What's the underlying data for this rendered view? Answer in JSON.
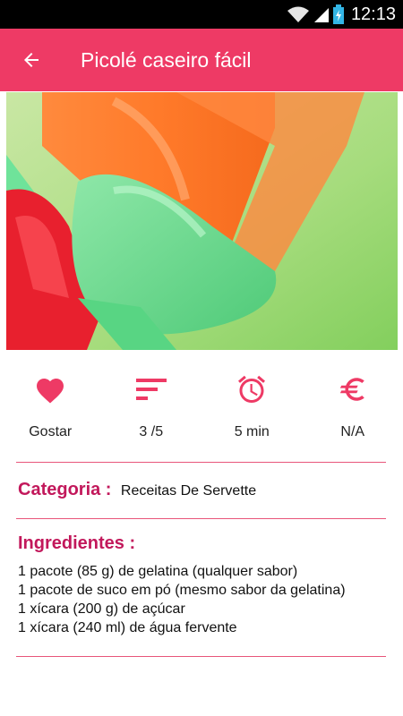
{
  "status_bar": {
    "time": "12:13"
  },
  "app_bar": {
    "title": "Picolé caseiro fácil"
  },
  "stats": [
    {
      "icon": "heart-icon",
      "label": "Gostar"
    },
    {
      "icon": "difficulty-icon",
      "label": "3 /5"
    },
    {
      "icon": "alarm-clock-icon",
      "label": "5 min"
    },
    {
      "icon": "euro-icon",
      "label": "N/A"
    }
  ],
  "category": {
    "heading": "Categoria :",
    "value": "Receitas De Servette"
  },
  "ingredients": {
    "heading": "Ingredientes :",
    "items": [
      "1 pacote (85 g) de gelatina (qualquer sabor)",
      "1 pacote de suco em pó (mesmo sabor da gelatina)",
      "1 xícara (200 g) de açúcar",
      "1 xícara (240 ml) de água fervente"
    ]
  },
  "colors": {
    "accent": "#ee3a65",
    "heading": "#c2185b",
    "status_bar": "#000000"
  }
}
